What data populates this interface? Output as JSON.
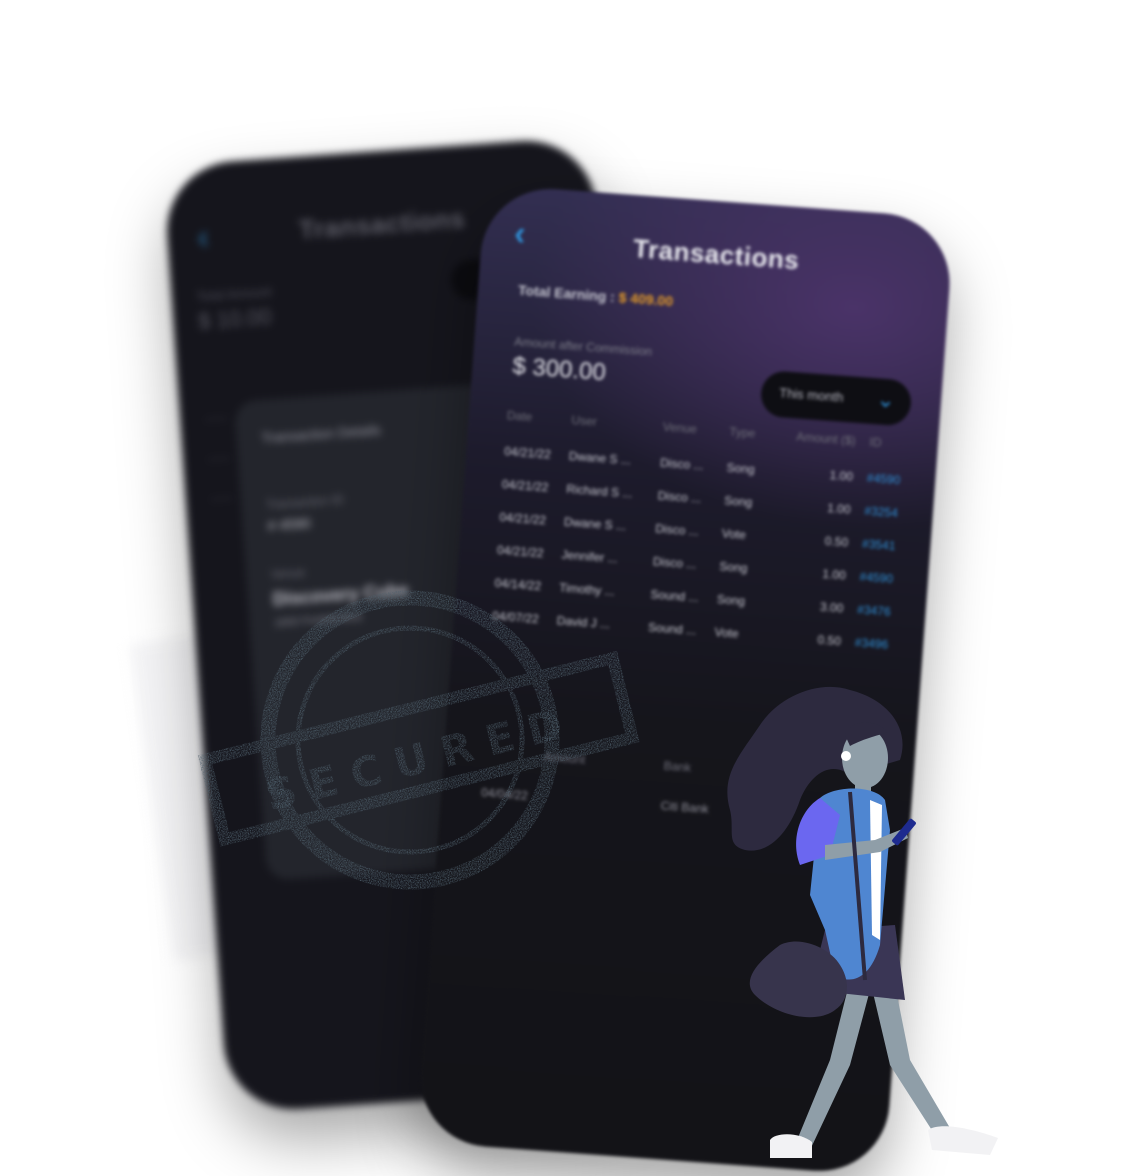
{
  "back_phone": {
    "back_glyph": "‹",
    "title": "Transactions",
    "label": "Total Amount",
    "amount": "$ 10.00",
    "detail_card": {
      "title": "Transaction Details",
      "id_label": "Transaction ID",
      "id_value": "# 4590",
      "venue_label": "Venue",
      "venue_value": "Discovery Cube",
      "venue_address": "1600 Foothill Blvd"
    }
  },
  "front_phone": {
    "back_glyph": "‹",
    "title": "Transactions",
    "earning_label": "Total Earning : ",
    "earning_value": "$ 409.00",
    "commission_label": "Amount after Commission",
    "commission_amount": "$ 300.00",
    "period_select": "This month",
    "chevron_glyph": "⌄",
    "table": {
      "headers": [
        "Date",
        "User",
        "Venue",
        "Type",
        "Amount ($)",
        "ID"
      ],
      "rows": [
        [
          "04/21/22",
          "Dwane S ...",
          "Disco ...",
          "Song",
          "1.00",
          "#4590"
        ],
        [
          "04/21/22",
          "Richard S ...",
          "Disco ...",
          "Song",
          "1.00",
          "#3254"
        ],
        [
          "04/21/22",
          "Dwane S ...",
          "Disco ...",
          "Vote",
          "0.50",
          "#3541"
        ],
        [
          "04/21/22",
          "Jennifer ...",
          "Disco ...",
          "Song",
          "1.00",
          "#4590"
        ],
        [
          "04/14/22",
          "Timothy ...",
          "Sound ...",
          "Song",
          "3.00",
          "#3476"
        ],
        [
          "04/07/22",
          "David J ...",
          "Sound ...",
          "Vote",
          "0.50",
          "#3496"
        ]
      ]
    },
    "payout": {
      "amount_label": "Amount",
      "bank_label": "Bank",
      "date": "04/04/22",
      "bank_value": "Citi Bank"
    }
  },
  "stamp": {
    "text": "SECURED",
    "color": "#4e5f6b"
  },
  "colors": {
    "accent_blue": "#2f8fd6",
    "earning_orange": "#e39a2a",
    "phone_dark": "#15151b"
  }
}
